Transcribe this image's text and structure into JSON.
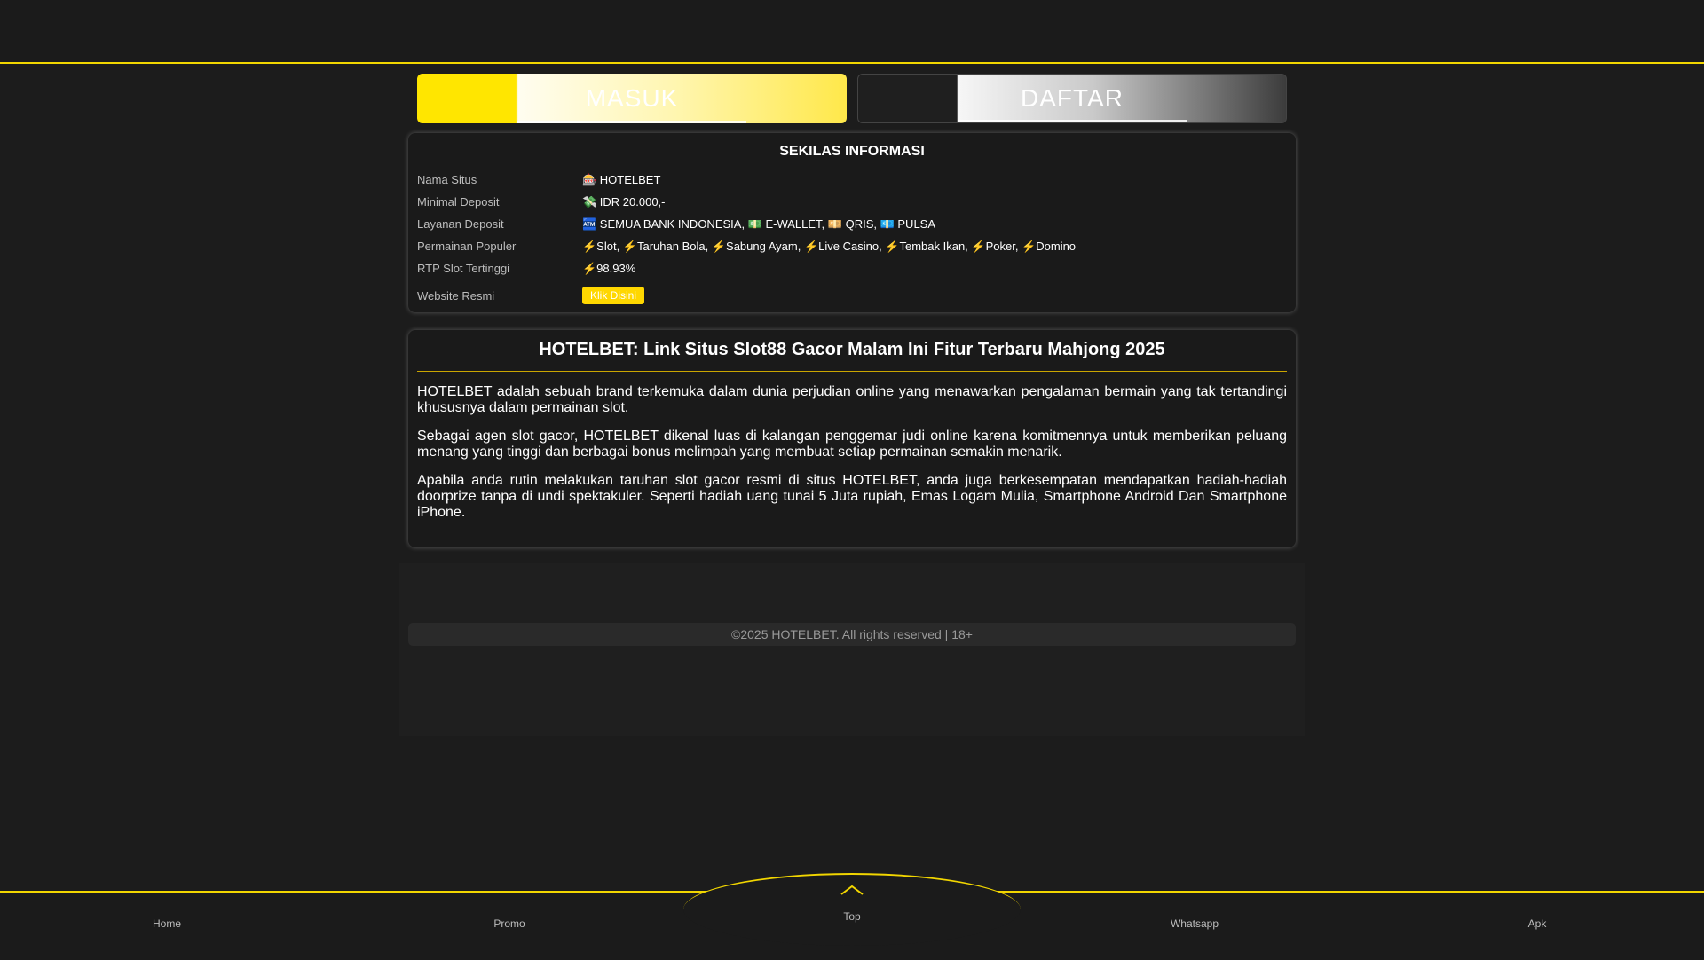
{
  "buttons": {
    "login": "MASUK",
    "register": "DAFTAR"
  },
  "info": {
    "title": "SEKILAS INFORMASI",
    "rows": [
      {
        "key": "Nama Situs",
        "value": "🎰 HOTELBET"
      },
      {
        "key": "Minimal Deposit",
        "value": "💸 IDR 20.000,-"
      },
      {
        "key": "Layanan Deposit",
        "value": "🏧 SEMUA BANK INDONESIA, 💵 E-WALLET, 💴 QRIS, 💶 PULSA"
      },
      {
        "key": "Permainan Populer",
        "value": "⚡Slot, ⚡Taruhan Bola, ⚡Sabung Ayam, ⚡Live Casino, ⚡Tembak Ikan, ⚡Poker, ⚡Domino"
      },
      {
        "key": "RTP Slot Tertinggi",
        "value": "⚡98.93%"
      }
    ],
    "website_key": "Website Resmi",
    "website_button": "Klik Disini"
  },
  "article": {
    "title": "HOTELBET: Link Situs Slot88 Gacor Malam Ini Fitur Terbaru Mahjong 2025",
    "paragraphs": [
      "HOTELBET adalah sebuah brand terkemuka dalam dunia perjudian online yang menawarkan pengalaman bermain yang tak tertandingi khususnya dalam permainan slot.",
      "Sebagai agen slot gacor, HOTELBET dikenal luas di kalangan penggemar judi online karena komitmennya untuk memberikan peluang menang yang tinggi dan berbagai bonus melimpah yang membuat setiap permainan semakin menarik.",
      "Apabila anda rutin melakukan taruhan slot gacor resmi di situs HOTELBET, anda juga berkesempatan mendapatkan hadiah-hadiah doorprize tanpa di undi spektakuler. Seperti hadiah uang tunai 5 Juta rupiah, Emas Logam Mulia, Smartphone Android Dan Smartphone iPhone."
    ]
  },
  "footer": {
    "copyright": "©2025 HOTELBET. All rights reserved | 18+"
  },
  "bottom_nav": {
    "home": "Home",
    "promo": "Promo",
    "top": "Top",
    "whatsapp": "Whatsapp",
    "apk": "Apk"
  },
  "colors": {
    "accent": "#f2d600",
    "background": "#1c1c1c"
  }
}
